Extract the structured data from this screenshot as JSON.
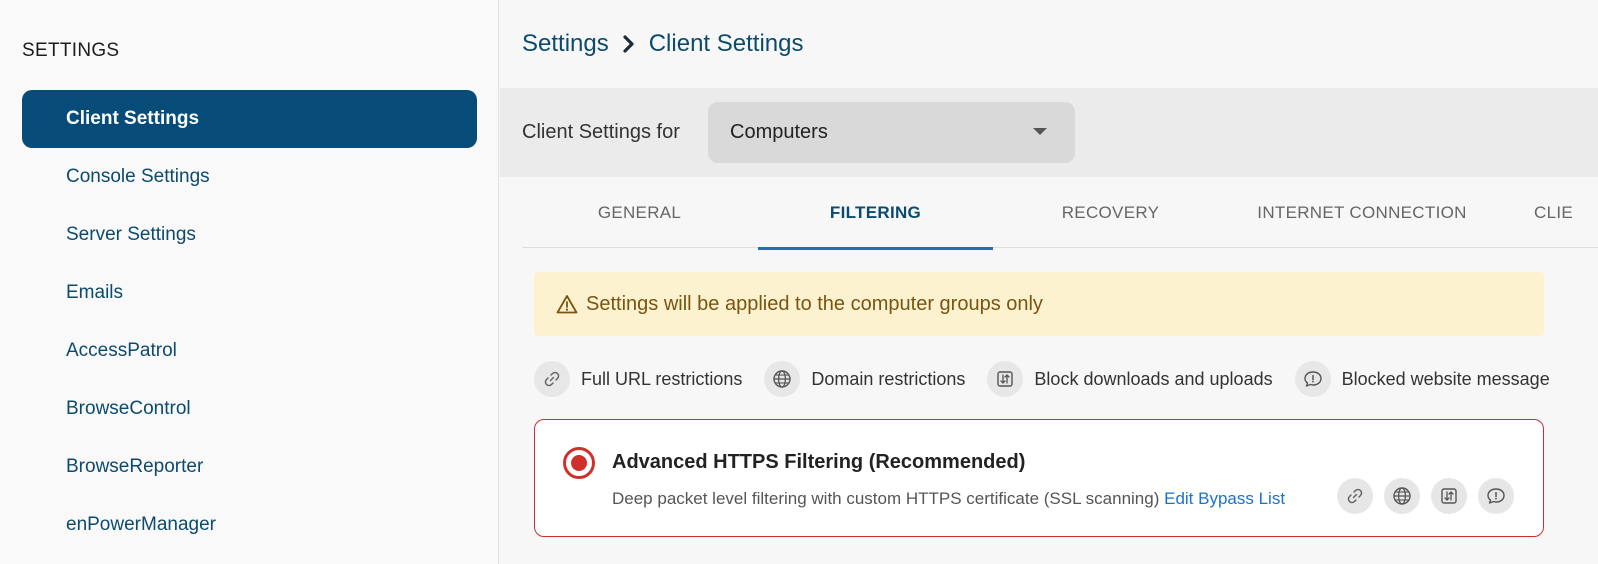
{
  "sidebar": {
    "heading": "SETTINGS",
    "items": [
      {
        "label": "Client Settings",
        "active": true
      },
      {
        "label": "Console Settings"
      },
      {
        "label": "Server Settings"
      },
      {
        "label": "Emails"
      },
      {
        "label": "AccessPatrol"
      },
      {
        "label": "BrowseControl"
      },
      {
        "label": "BrowseReporter"
      },
      {
        "label": "enPowerManager"
      }
    ]
  },
  "breadcrumb": {
    "root": "Settings",
    "current": "Client Settings"
  },
  "settings_for": {
    "label": "Client Settings for",
    "selected": "Computers"
  },
  "tabs": [
    {
      "label": "GENERAL"
    },
    {
      "label": "FILTERING",
      "active": true
    },
    {
      "label": "RECOVERY"
    },
    {
      "label": "INTERNET CONNECTION"
    },
    {
      "label": "CLIE"
    }
  ],
  "alert": {
    "text": "Settings will be applied to the computer groups only",
    "icon": "warning-icon"
  },
  "features": [
    {
      "label": "Full URL restrictions",
      "icon": "link-icon"
    },
    {
      "label": "Domain restrictions",
      "icon": "globe-icon"
    },
    {
      "label": "Block downloads and uploads",
      "icon": "transfer-icon"
    },
    {
      "label": "Blocked website message",
      "icon": "message-icon"
    }
  ],
  "option": {
    "title": "Advanced HTTPS Filtering (Recommended)",
    "description": "Deep packet level filtering with custom HTTPS certificate (SSL scanning)",
    "link": "Edit Bypass List",
    "selected": true
  },
  "colors": {
    "primary": "#074c78",
    "accent_red": "#d0302b",
    "link": "#1a73c9",
    "alert_bg": "#fdf2cf"
  }
}
